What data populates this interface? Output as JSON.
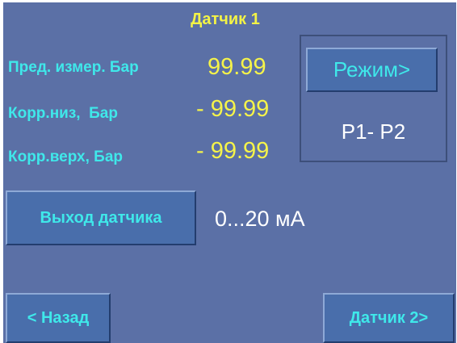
{
  "header": {
    "title": "Датчик 1"
  },
  "params": [
    {
      "label": "Пред. измер. Бар",
      "value": "99.99"
    },
    {
      "label": "Корр.низ,  Бар",
      "value": "- 99.99"
    },
    {
      "label": "Корр.верх, Бар",
      "value": "- 99.99"
    }
  ],
  "mode": {
    "button_label": "Режим>",
    "value": "P1- P2"
  },
  "output": {
    "button_label": "Выход датчика",
    "value": "0...20 мА"
  },
  "nav": {
    "back_label": "< Назад",
    "next_label": "Датчик 2>"
  },
  "colors": {
    "background": "#5b70a6",
    "label": "#3fe8ea",
    "value": "#f5f34a",
    "title": "#f3f346",
    "button_face": "#496eab",
    "text_white": "#ffffff"
  }
}
